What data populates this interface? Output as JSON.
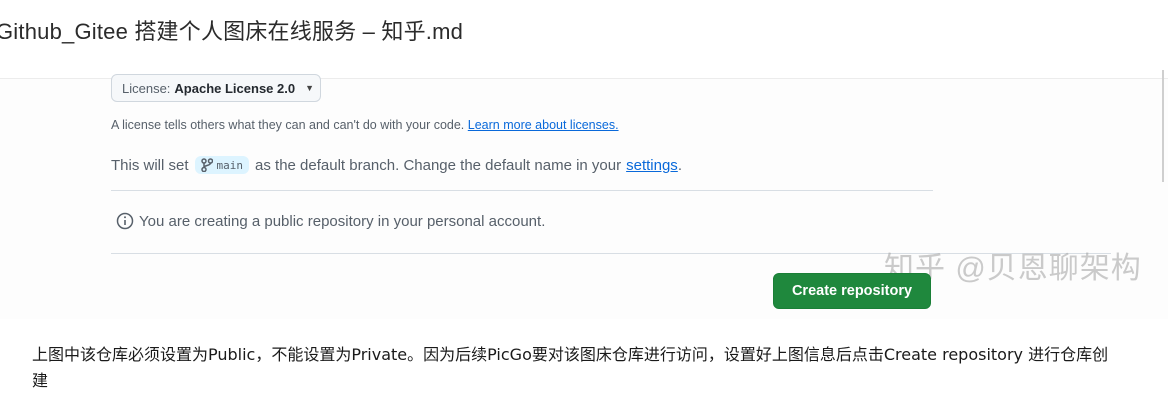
{
  "document": {
    "title": "Github_Gitee 搭建个人图床在线服务 – 知乎.md"
  },
  "screenshot": {
    "license_select": {
      "label": "License:",
      "value": "Apache License 2.0"
    },
    "license_help": {
      "text": "A license tells others what they can and can't do with your code.",
      "link": "Learn more about licenses."
    },
    "branch": {
      "prefix": "This will set",
      "branch_name": "main",
      "middle": "as the default branch. Change the default name in your",
      "settings_link": "settings",
      "suffix": "."
    },
    "public_notice": "You are creating a public repository in your personal account.",
    "create_button": "Create repository",
    "watermark": "知乎 @贝恩聊架构"
  },
  "caption": {
    "line1": "上图中该仓库必须设置为Public，不能设置为Private。因为后续PicGo要对该图床仓库进行访问，设置好上图信息后点击Create repository 进行仓库创",
    "line2": "建"
  },
  "colors": {
    "primary_button": "#1f883d",
    "link": "#0969da",
    "branch_pill": "#ddf4ff"
  }
}
